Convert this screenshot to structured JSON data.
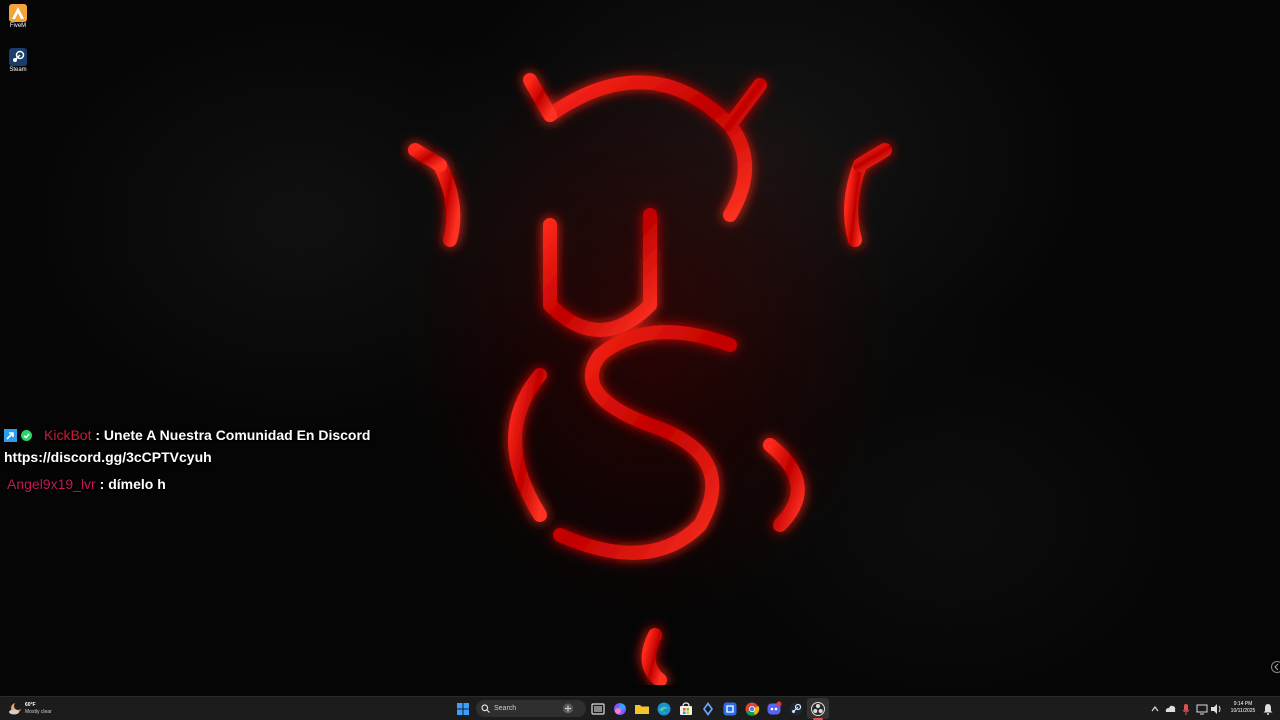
{
  "desktop_icons": [
    {
      "label": "FiveM",
      "icon": "fivem-icon",
      "color": "#f2a33a"
    },
    {
      "label": "Steam",
      "icon": "steam-icon",
      "color": "#1b3d6b"
    }
  ],
  "chat": {
    "messages": [
      {
        "username": "KickBot",
        "username_color": "#d11a3a",
        "separator": " : ",
        "text": "Unete A Nuestra Comunidad En Discord",
        "continuation": "https://discord.gg/3cCPTVcyuh"
      },
      {
        "username": "Angel9x19_lvr",
        "username_color": "#c2185b",
        "separator": " : ",
        "text": "dímelo h"
      }
    ]
  },
  "taskbar": {
    "weather": {
      "temp": "60°F",
      "condition": "Mostly clear"
    },
    "search_label": "Search",
    "clock": {
      "time": "9:14 PM",
      "date": "10/11/2025"
    },
    "pinned_apps": [
      "start-icon",
      "task-view-icon",
      "copilot-icon",
      "file-explorer-icon",
      "edge-icon",
      "store-icon",
      "app-icon",
      "chrome-icon",
      "discord-icon",
      "steam-icon",
      "obs-icon"
    ]
  },
  "colors": {
    "emblem_red": "#e00000",
    "taskbar_bg": "#1c1c1c"
  }
}
